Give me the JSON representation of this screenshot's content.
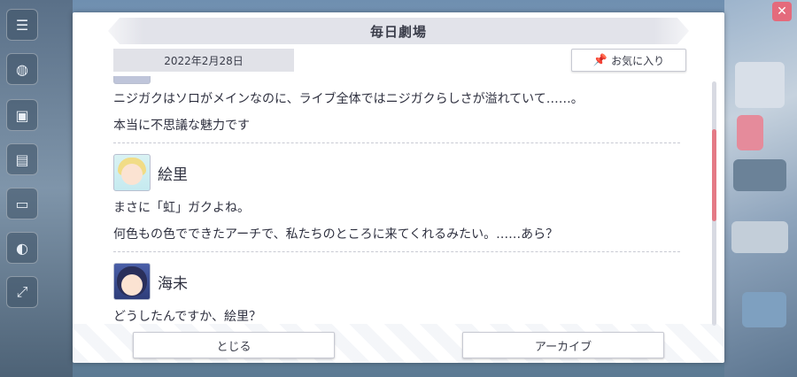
{
  "dialog": {
    "title": "毎日劇場",
    "date": "2022年2月28日",
    "favorite_label": "お気に入り",
    "favorite_icon": "pin-icon"
  },
  "messages": {
    "prev_lines": [
      "ニジガクはソロがメインなのに、ライブ全体ではニジガクらしさが溢れていて……。",
      "本当に不思議な魅力です"
    ],
    "eli": {
      "name": "絵里",
      "lines": [
        "まさに「虹」ガクよね。",
        "何色もの色でできたアーチで、私たちのところに来てくれるみたい。……あら？"
      ]
    },
    "umi": {
      "name": "海未",
      "lines": [
        "どうしたんですか、絵里？"
      ]
    }
  },
  "buttons": {
    "close_label": "とじる",
    "archive_label": "アーカイブ"
  },
  "scrollbar": {
    "thumb_color": "#e47a86"
  },
  "colors": {
    "title_bg": "#e2e3ea",
    "text": "#2f3140"
  }
}
